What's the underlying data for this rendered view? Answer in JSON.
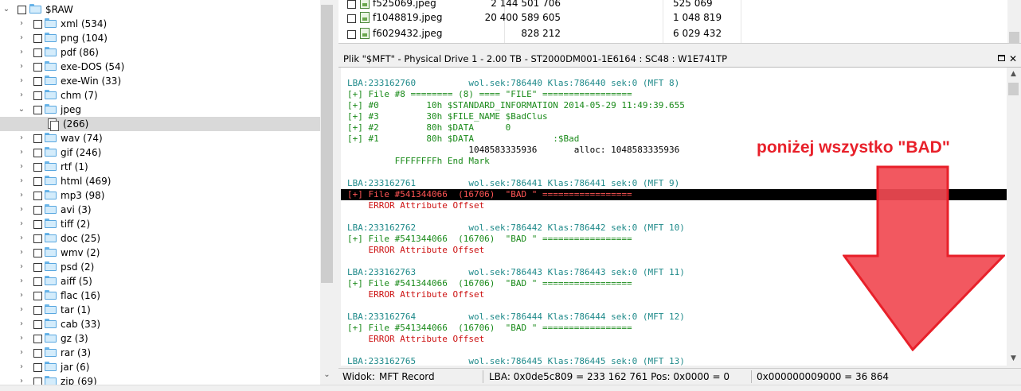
{
  "tree": {
    "root": {
      "label": "$RAW"
    },
    "items": [
      {
        "label": "xml (534)"
      },
      {
        "label": "png (104)"
      },
      {
        "label": "pdf (86)"
      },
      {
        "label": "exe-DOS (54)"
      },
      {
        "label": "exe-Win (33)"
      },
      {
        "label": "chm (7)"
      },
      {
        "label": "jpeg"
      },
      {
        "label": "(266)"
      },
      {
        "label": "wav (74)"
      },
      {
        "label": "gif (246)"
      },
      {
        "label": "rtf (1)"
      },
      {
        "label": "html (469)"
      },
      {
        "label": "mp3 (98)"
      },
      {
        "label": "avi (3)"
      },
      {
        "label": "tiff (2)"
      },
      {
        "label": "doc (25)"
      },
      {
        "label": "wmv (2)"
      },
      {
        "label": "psd (2)"
      },
      {
        "label": "aiff (5)"
      },
      {
        "label": "flac (16)"
      },
      {
        "label": "tar (1)"
      },
      {
        "label": "cab (33)"
      },
      {
        "label": "gz (3)"
      },
      {
        "label": "rar (3)"
      },
      {
        "label": "jar (6)"
      },
      {
        "label": "zip (69)"
      }
    ]
  },
  "files": {
    "rows": [
      {
        "name": "f525069.jpeg",
        "offset": "2 144 501 706",
        "size": "525 069"
      },
      {
        "name": "f1048819.jpeg",
        "offset": "20 400 589 605",
        "size": "1 048 819"
      },
      {
        "name": "f6029432.jpeg",
        "offset": "828 212",
        "size": "6 029 432"
      }
    ]
  },
  "mft": {
    "title": "Plik \"$MFT\" - Physical Drive 1 - 2.00 TB - ST2000DM001-1E6164 : SC48 : W1E741TP",
    "lines": [
      "LBA:233162760          wol.sek:786440 Klas:786440 sek:0 (MFT 8)",
      "[+] File #8 ======== (8) ==== \"FILE\" =================",
      "[+] #0         10h $STANDARD_INFORMATION 2014-05-29 11:49:39.655",
      "[+] #3         30h $FILE_NAME $BadClus",
      "[+] #2         80h $DATA      0",
      "[+] #1         80h $DATA               :$Bad",
      "                       1048583335936       alloc: 1048583335936",
      "         FFFFFFFFh End Mark",
      "LBA:233162761          wol.sek:786441 Klas:786441 sek:0 (MFT 9)",
      "[+] File #541344066  (16706)  \"BAD \" =================",
      "    ERROR Attribute Offset",
      "LBA:233162762          wol.sek:786442 Klas:786442 sek:0 (MFT 10)",
      "[+] File #541344066  (16706)  \"BAD \" =================",
      "    ERROR Attribute Offset",
      "LBA:233162763          wol.sek:786443 Klas:786443 sek:0 (MFT 11)",
      "[+] File #541344066  (16706)  \"BAD \" =================",
      "    ERROR Attribute Offset",
      "LBA:233162764          wol.sek:786444 Klas:786444 sek:0 (MFT 12)",
      "[+] File #541344066  (16706)  \"BAD \" =================",
      "    ERROR Attribute Offset",
      "LBA:233162765          wol.sek:786445 Klas:786445 sek:0 (MFT 13)"
    ]
  },
  "status": {
    "view": "Widok:",
    "view_value": "MFT Record",
    "lba": "LBA: 0x0de5c809 = 233 162 761  Pos: 0x0000 = 0",
    "hex": "0x000000009000 = 36 864"
  },
  "annotation": {
    "text": "poniżej wszystko \"BAD\"",
    "color": "#e8202a"
  },
  "colors": {
    "teal": "#1f8a8a",
    "green": "#1a8a1a",
    "red": "#cc1111",
    "highlight": "#000000",
    "selection": "#d9d9d9"
  }
}
